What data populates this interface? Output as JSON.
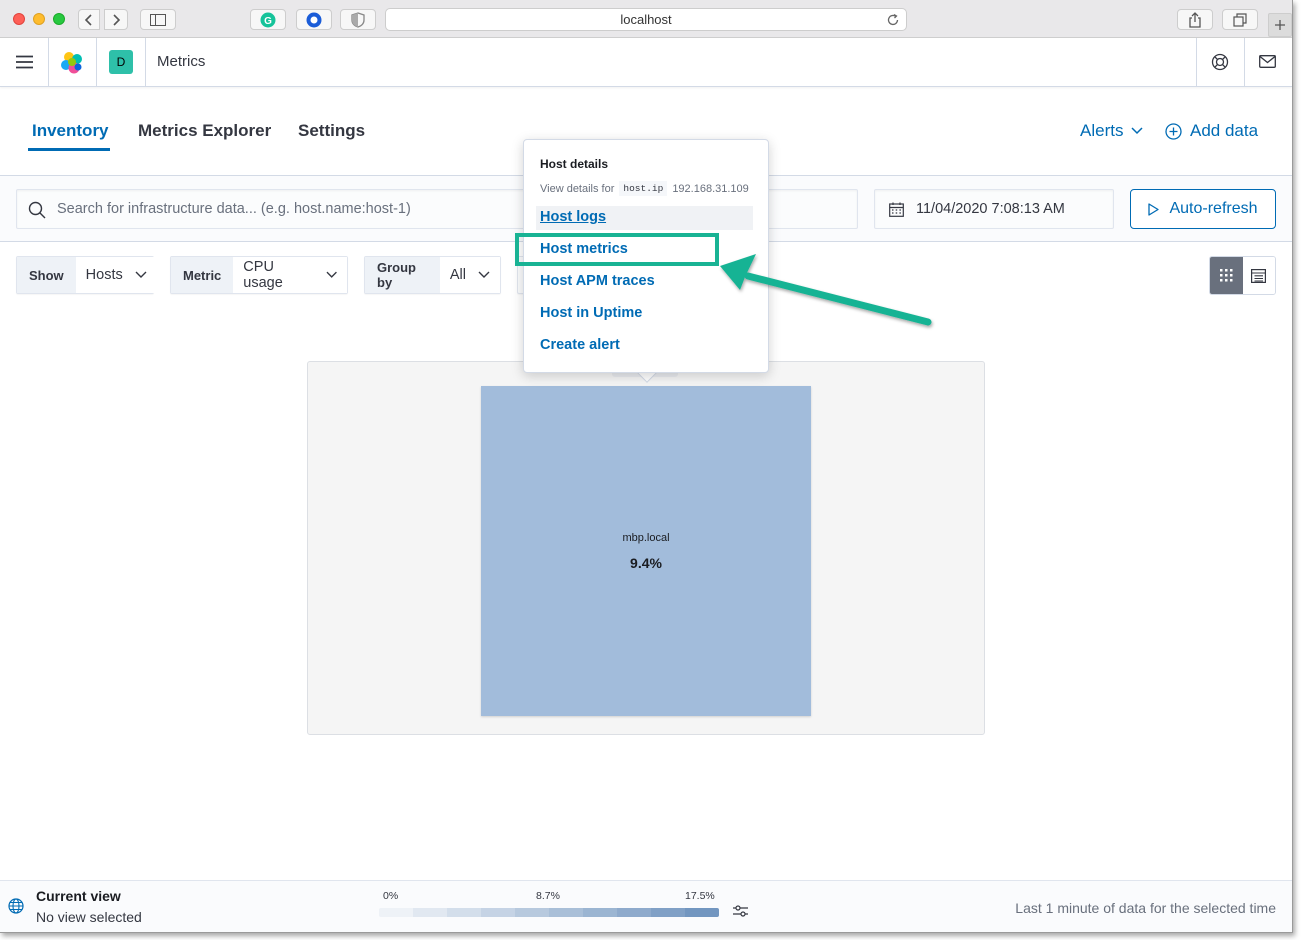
{
  "browser": {
    "url": "localhost"
  },
  "header": {
    "space_initial": "D",
    "app_title": "Metrics"
  },
  "tabs": [
    {
      "label": "Inventory",
      "active": true
    },
    {
      "label": "Metrics Explorer",
      "active": false
    },
    {
      "label": "Settings",
      "active": false
    }
  ],
  "header_links": {
    "alerts": "Alerts",
    "add_data": "Add data"
  },
  "search": {
    "placeholder": "Search for infrastructure data... (e.g. host.name:host-1)"
  },
  "time": {
    "value": "11/04/2020 7:08:13 AM",
    "auto_refresh_label": "Auto-refresh"
  },
  "toolbar": {
    "show": {
      "label": "Show",
      "value": "Hosts"
    },
    "metric": {
      "label": "Metric",
      "value": "CPU usage"
    },
    "group_by": {
      "label": "Group by",
      "value": "All"
    }
  },
  "node": {
    "name": "mbp.local",
    "value": "9.4%",
    "fill_color": "#a2bcdb"
  },
  "popover": {
    "title": "Host details",
    "subtitle_prefix": "View details for",
    "field": "host.ip",
    "ip": "192.168.31.109",
    "links": [
      "Host logs",
      "Host metrics",
      "Host APM traces",
      "Host in Uptime",
      "Create alert"
    ]
  },
  "annotation": {
    "color": "#19b394"
  },
  "bottom": {
    "current_view_title": "Current view",
    "current_view_value": "No view selected",
    "legend_ticks": [
      "0%",
      "8.7%",
      "17.5%"
    ],
    "legend_colors": [
      "#eef2f7",
      "#e1e8f1",
      "#d3deeb",
      "#c5d3e5",
      "#b7c9de",
      "#a9bfd8",
      "#9bb5d2",
      "#8eaacc",
      "#80a0c6",
      "#7296c0"
    ],
    "status": "Last 1 minute of data for the selected time"
  },
  "colors": {
    "primary": "#006bb4",
    "text": "#343741"
  }
}
